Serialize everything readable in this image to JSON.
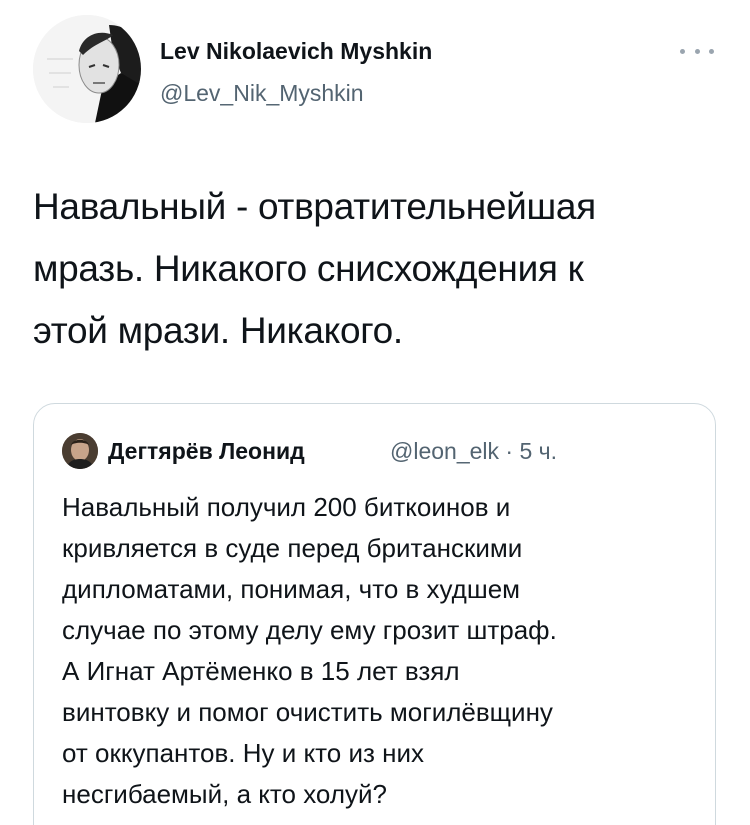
{
  "author": {
    "display_name": "Lev Nikolaevich Myshkin",
    "handle": "@Lev_Nik_Myshkin"
  },
  "tweet": {
    "text": "Навальный - отвратительнейшая\nмразь. Никакого снисхождения к\nэтой мрази. Никакого."
  },
  "quoted_tweet": {
    "display_name": "Дегтярёв Леонид",
    "handle": "@leon_elk",
    "separator": "·",
    "time": "5 ч.",
    "text": "Навальный получил 200 биткоинов и\nкривляется в суде перед британскими\nдипломатами, понимая, что в худшем\nслучае по этому делу ему грозит штраф.\nА Игнат Артёменко в 15 лет взял\nвинтовку и помог очистить могилёвщину\nот оккупантов. Ну и кто из них\nнесгибаемый, а кто холуй?"
  },
  "icons": {
    "more": "more-horizontal-icon"
  },
  "colors": {
    "text": "#0f1419",
    "secondary": "#536471",
    "border": "#cfd9de",
    "background": "#ffffff"
  }
}
